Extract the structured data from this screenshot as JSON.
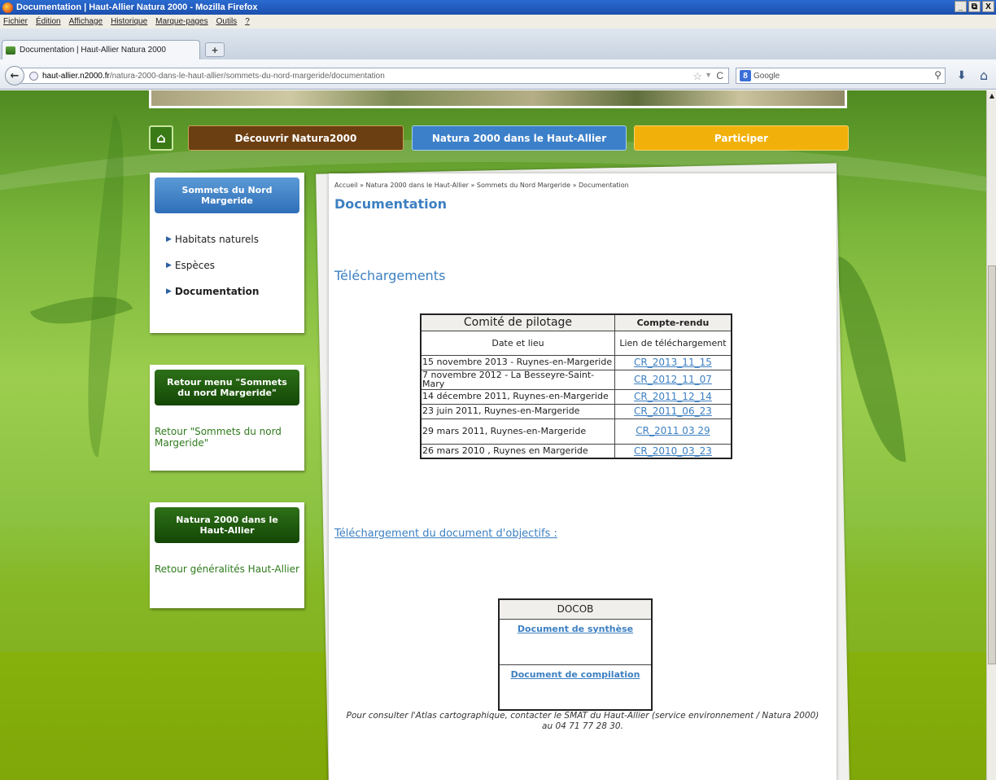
{
  "window": {
    "title": "Documentation | Haut-Allier Natura 2000 - Mozilla Firefox",
    "controls": [
      "_",
      "ȅ",
      "X"
    ]
  },
  "menu": [
    "Fichier",
    "Édition",
    "Affichage",
    "Historique",
    "Marque-pages",
    "Outils",
    "?"
  ],
  "tab": {
    "title": "Documentation | Haut-Allier Natura 2000",
    "new_tab": "+"
  },
  "urlbar": {
    "domain": "haut-allier.n2000.fr",
    "path": "/natura-2000-dans-le-haut-allier/sommets-du-nord-margeride/documentation"
  },
  "search": {
    "engine_letter": "8",
    "placeholder": "Google"
  },
  "topnav": {
    "decouvrir": "Découvrir Natura2000",
    "haut_allier": "Natura 2000 dans le Haut-Allier",
    "participer": "Participer"
  },
  "sidebar": {
    "box1": {
      "title": "Sommets du Nord Margeride",
      "items": [
        "Habitats naturels",
        "Espèces",
        "Documentation"
      ]
    },
    "box2": {
      "title": "Retour menu \"Sommets du nord Margeride\"",
      "link": "Retour \"Sommets du nord Margeride\""
    },
    "box3": {
      "title": "Natura 2000 dans le Haut-Allier",
      "link": "Retour généralités Haut-Allier"
    }
  },
  "content": {
    "breadcrumb": "Accueil » Natura 2000 dans le Haut-Allier » Sommets du Nord Margeride » Documentation",
    "title": "Documentation",
    "section_title": "Téléchargements",
    "table": {
      "header_left": "Comité de pilotage",
      "header_right": "Compte-rendu",
      "sub_left": "Date et lieu",
      "sub_right": "Lien de téléchargement",
      "rows": [
        {
          "lieu": "15 novembre 2013 - Ruynes-en-Margeride",
          "cr": "CR_2013_11_15"
        },
        {
          "lieu": "7 novembre 2012 - La Besseyre-Saint-Mary",
          "cr": "CR_2012_11_07"
        },
        {
          "lieu": "14 décembre 2011, Ruynes-en-Margeride",
          "cr": "CR_2011_12_14"
        },
        {
          "lieu": "23 juin 2011, Ruynes-en-Margeride",
          "cr": "CR_2011_06_23"
        },
        {
          "lieu": " 29 mars 2011, Ruynes-en-Margeride",
          "cr": "CR_2011 03 29"
        },
        {
          "lieu": "26 mars 2010 , Ruynes en Margeride",
          "cr": "CR_2010_03_23"
        }
      ]
    },
    "docob_title": "Téléchargement du document d'objectifs :",
    "docob": {
      "header": "DOCOB",
      "synthese": "Document de synthèse",
      "compilation": "Document de compilation"
    },
    "footnote": "Pour consulter l'Atlas cartographique, contacter le SMAT du Haut-Allier (service environnement / Natura 2000) au 04 71 77 28 30."
  },
  "colors": {
    "link_blue": "#3d80c2",
    "green_dark": "#144706",
    "brown": "#6c3f12",
    "blue_button": "#3c80c9",
    "orange": "#f2b10a"
  }
}
